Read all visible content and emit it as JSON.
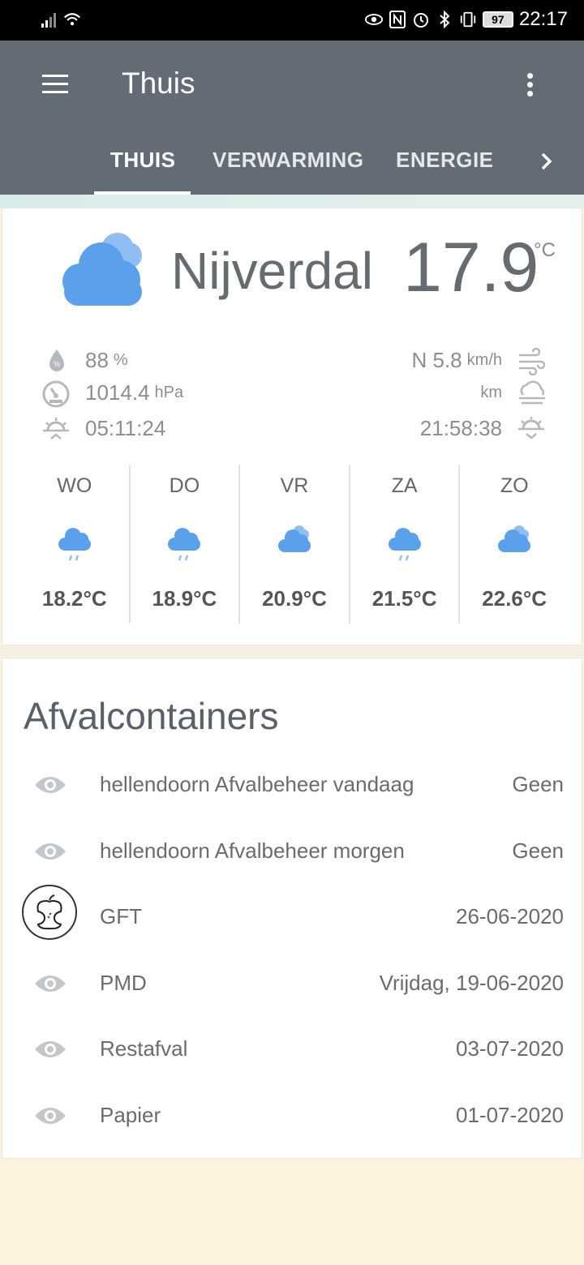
{
  "status_bar": {
    "time": "22:17",
    "battery": "97",
    "icons": [
      "signal-icon",
      "wifi-icon",
      "eye-icon",
      "nfc-icon",
      "alarm-icon",
      "bluetooth-icon",
      "vibrate-icon",
      "battery-icon"
    ]
  },
  "app_bar": {
    "title": "Thuis",
    "tabs": [
      {
        "label": "THUIS",
        "active": true
      },
      {
        "label": "VERWARMING",
        "active": false
      },
      {
        "label": "ENERGIE",
        "active": false
      }
    ]
  },
  "weather": {
    "city": "Nijverdal",
    "temperature": "17.9",
    "temperature_unit": "°C",
    "humidity": "88",
    "humidity_unit": "%",
    "pressure": "1014.4",
    "pressure_unit": "hPa",
    "sunrise": "05:11:24",
    "wind": "N 5.8",
    "wind_unit": "km/h",
    "visibility_unit": "km",
    "sunset": "21:58:38",
    "forecast": [
      {
        "day": "WO",
        "temp": "18.2°C",
        "icon": "rain-cloud-icon"
      },
      {
        "day": "DO",
        "temp": "18.9°C",
        "icon": "rain-cloud-icon"
      },
      {
        "day": "VR",
        "temp": "20.9°C",
        "icon": "cloud-icon"
      },
      {
        "day": "ZA",
        "temp": "21.5°C",
        "icon": "rain-cloud-icon"
      },
      {
        "day": "ZO",
        "temp": "22.6°C",
        "icon": "cloud-icon"
      }
    ]
  },
  "waste": {
    "title": "Afvalcontainers",
    "rows": [
      {
        "name": "hellendoorn Afvalbeheer vandaag",
        "value": "Geen",
        "icon": "eye-icon"
      },
      {
        "name": "hellendoorn Afvalbeheer morgen",
        "value": "Geen",
        "icon": "eye-icon"
      },
      {
        "name": "GFT",
        "value": "26-06-2020",
        "icon": "apple-core-icon"
      },
      {
        "name": "PMD",
        "value": "Vrijdag, 19-06-2020",
        "icon": "eye-icon"
      },
      {
        "name": "Restafval",
        "value": "03-07-2020",
        "icon": "eye-icon"
      },
      {
        "name": "Papier",
        "value": "01-07-2020",
        "icon": "eye-icon"
      }
    ]
  },
  "colors": {
    "app_bar": "#636b75",
    "weather_blue": "#5ba0ea",
    "background": "#fdf2dd"
  }
}
